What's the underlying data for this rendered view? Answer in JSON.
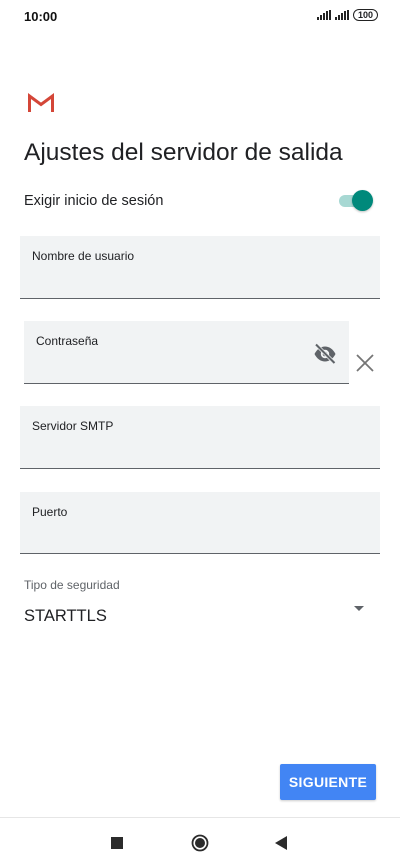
{
  "status_bar": {
    "time": "10:00",
    "battery": "100"
  },
  "icons": {
    "app_logo": "gmail-logo-icon",
    "password_visibility": "eye-off-icon",
    "clear": "close-icon",
    "dropdown": "arrow-drop-down-icon",
    "nav_recent": "square-icon",
    "nav_home": "circle-icon",
    "nav_back": "triangle-back-icon"
  },
  "header": {
    "title": "Ajustes del servidor de salida"
  },
  "login_toggle": {
    "label": "Exigir inicio de sesión",
    "on": true
  },
  "fields": {
    "username": {
      "label": "Nombre de usuario",
      "value": ""
    },
    "password": {
      "label": "Contraseña",
      "value": ""
    },
    "smtp_server": {
      "label": "Servidor SMTP",
      "value": ""
    },
    "port": {
      "label": "Puerto",
      "value": ""
    }
  },
  "security": {
    "label": "Tipo de seguridad",
    "selected": "STARTTLS"
  },
  "actions": {
    "next_label": "SIGUIENTE"
  },
  "colors": {
    "accent": "#00897b",
    "button": "#4285f4",
    "field_bg": "#f1f3f4",
    "gmail_red": "#d44638"
  }
}
